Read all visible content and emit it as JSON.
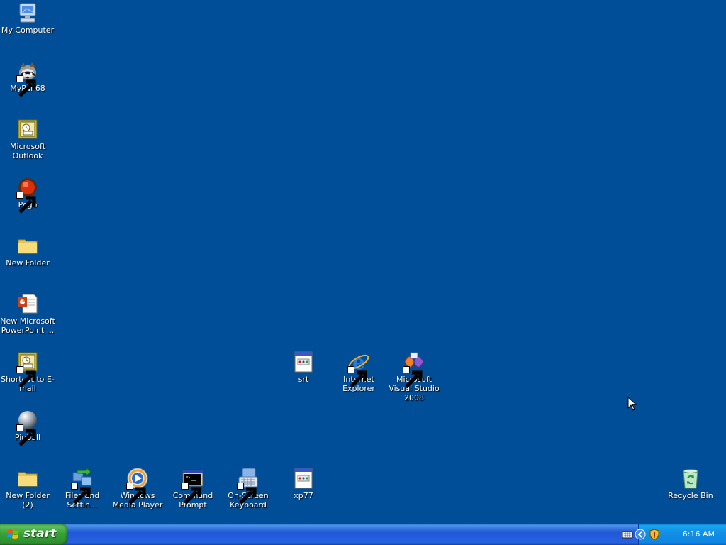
{
  "desktop": {
    "icons": [
      {
        "label": "My Computer",
        "icon": "my-computer-icon"
      },
      {
        "label": "MyPal 68",
        "icon": "mypal-icon",
        "shortcut": true
      },
      {
        "label": "Microsoft Outlook",
        "icon": "outlook-icon"
      },
      {
        "label": "Pego",
        "icon": "pego-icon",
        "shortcut": true
      },
      {
        "label": "New Folder",
        "icon": "folder-icon"
      },
      {
        "label": "New Microsoft PowerPoint ...",
        "icon": "powerpoint-icon"
      },
      {
        "label": "Shortcut to E-mail",
        "icon": "outlook-icon",
        "shortcut": true
      },
      {
        "label": "Pinball",
        "icon": "pinball-icon",
        "shortcut": true
      },
      {
        "label": "New Folder (2)",
        "icon": "folder-icon"
      },
      {
        "label": "Files and Settin...",
        "icon": "files-settings-icon",
        "shortcut": true
      },
      {
        "label": "Windows Media Player",
        "icon": "media-player-icon",
        "shortcut": true
      },
      {
        "label": "Command Prompt",
        "icon": "command-prompt-icon",
        "shortcut": true
      },
      {
        "label": "On-Screen Keyboard",
        "icon": "osk-icon",
        "shortcut": true
      },
      {
        "label": "xp77",
        "icon": "program-file-icon"
      },
      {
        "label": "srt",
        "icon": "program-file-icon"
      },
      {
        "label": "Internet Explorer",
        "icon": "ie-icon",
        "shortcut": true
      },
      {
        "label": "Microsoft Visual Studio 2008",
        "icon": "visual-studio-icon",
        "shortcut": true
      },
      {
        "label": "Recycle Bin",
        "icon": "recycle-bin-icon"
      }
    ]
  },
  "taskbar": {
    "start_label": "start",
    "clock": "6:16 AM",
    "tray_icons": [
      "keyboard-icon",
      "show-hidden-icon",
      "security-shield-icon"
    ]
  },
  "colors": {
    "desktop_bg": "#004e98",
    "taskbar_blue": "#245edb",
    "start_green": "#3c9a3c"
  }
}
